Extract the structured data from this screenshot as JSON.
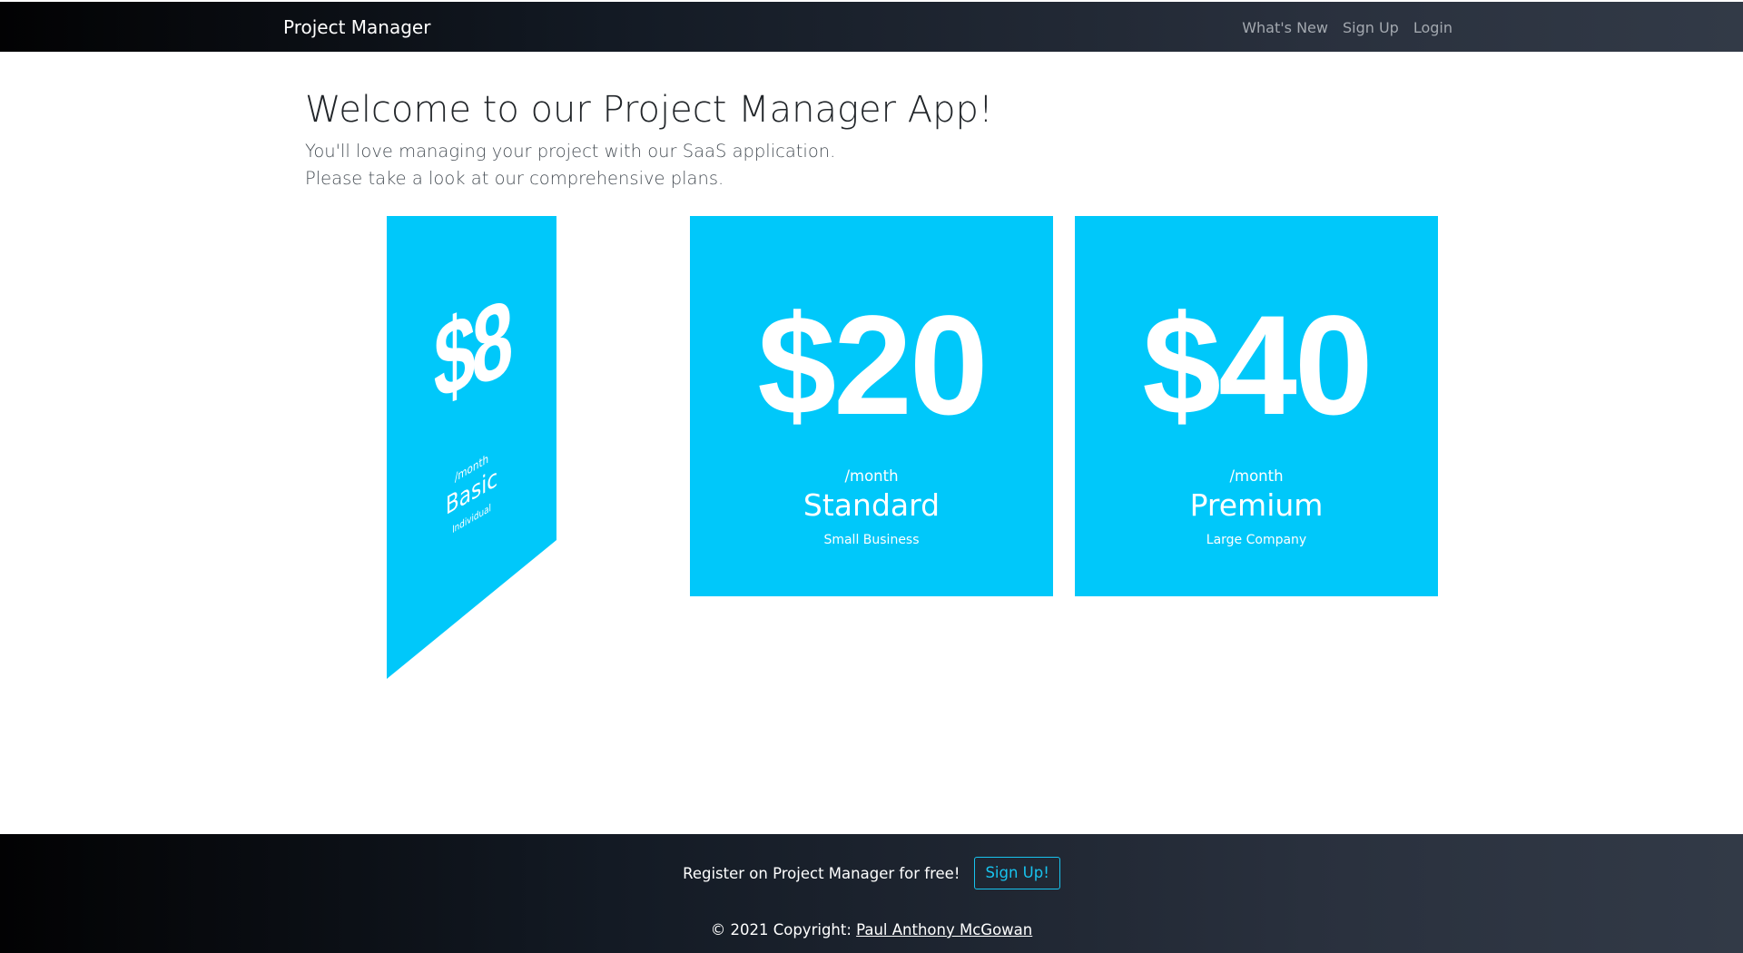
{
  "navbar": {
    "brand": "Project Manager",
    "links": [
      "What's New",
      "Sign Up",
      "Login"
    ]
  },
  "welcome": {
    "title": "Welcome to our Project Manager App!",
    "line1": "You'll love managing your project with our SaaS application.",
    "line2": "Please take a look at our comprehensive plans."
  },
  "plans": [
    {
      "price": "$8",
      "period": "/month",
      "name": "Basic",
      "audience": "Individual"
    },
    {
      "price": "$20",
      "period": "/month",
      "name": "Standard",
      "audience": "Small Business"
    },
    {
      "price": "$40",
      "period": "/month",
      "name": "Premium",
      "audience": "Large Company"
    }
  ],
  "footer": {
    "register_text": "Register on Project Manager for free!",
    "signup_label": "Sign Up!",
    "copyright_prefix": "© 2021 Copyright: ",
    "author": "Paul Anthony McGowan"
  },
  "colors": {
    "card": "#00c8fa",
    "accent": "#18c3ee",
    "navbar_dark": "#020203",
    "navbar_light": "#323a47"
  }
}
